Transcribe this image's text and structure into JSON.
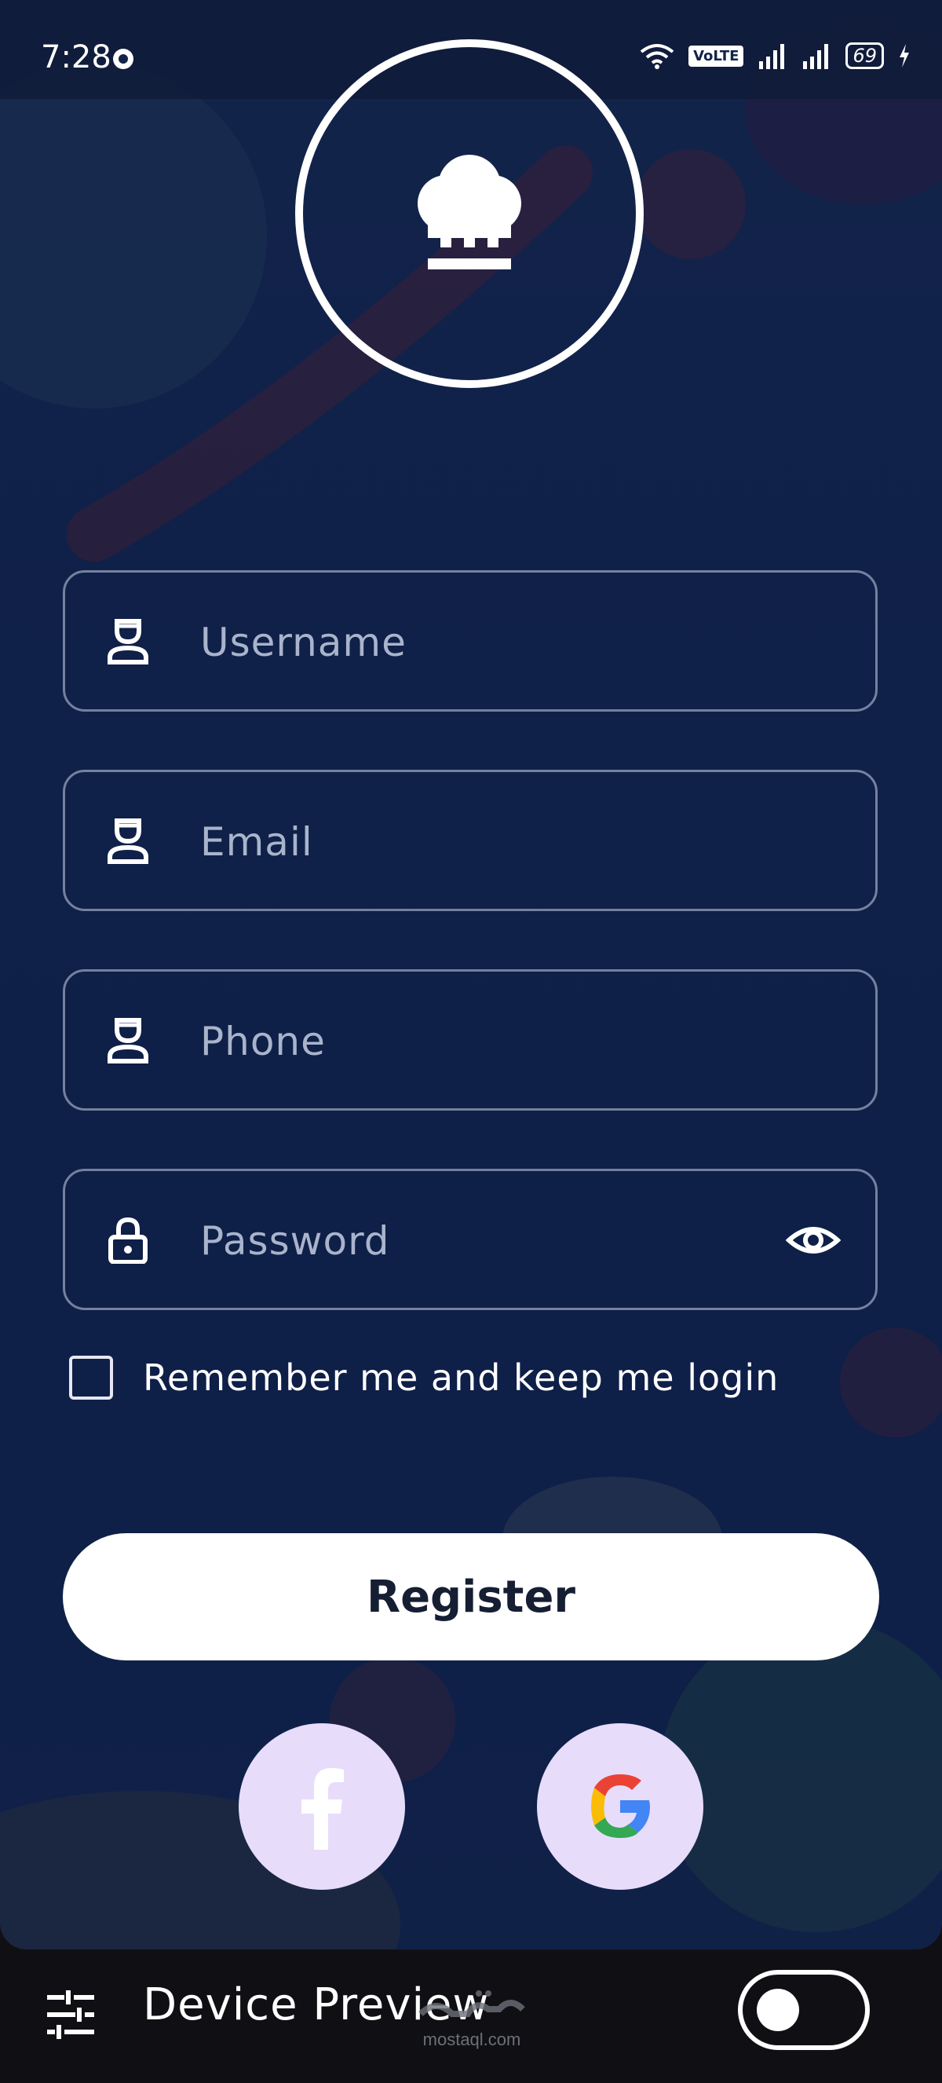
{
  "status_bar": {
    "time": "7:28",
    "network_badge": "VoLTE",
    "battery": "69"
  },
  "form": {
    "username_placeholder": "Username",
    "email_placeholder": "Email",
    "phone_placeholder": "Phone",
    "password_placeholder": "Password",
    "remember_label": "Remember me and keep me login",
    "remember_checked": false,
    "register_label": "Register"
  },
  "social": [
    "facebook",
    "google"
  ],
  "bottom_bar": {
    "label": "Device Preview",
    "watermark": "mostaql.com",
    "toggle_on": false
  },
  "icons": [
    "chef-hat-icon",
    "user-icon",
    "lock-icon",
    "eye-icon",
    "facebook-icon",
    "google-icon",
    "tune-icon"
  ],
  "colors": {
    "background": "#0f2049",
    "field_border": "#8e9bb8",
    "button_bg": "#ffffff",
    "social_bg": "#e8dcfb",
    "bar_bg": "#101014"
  }
}
